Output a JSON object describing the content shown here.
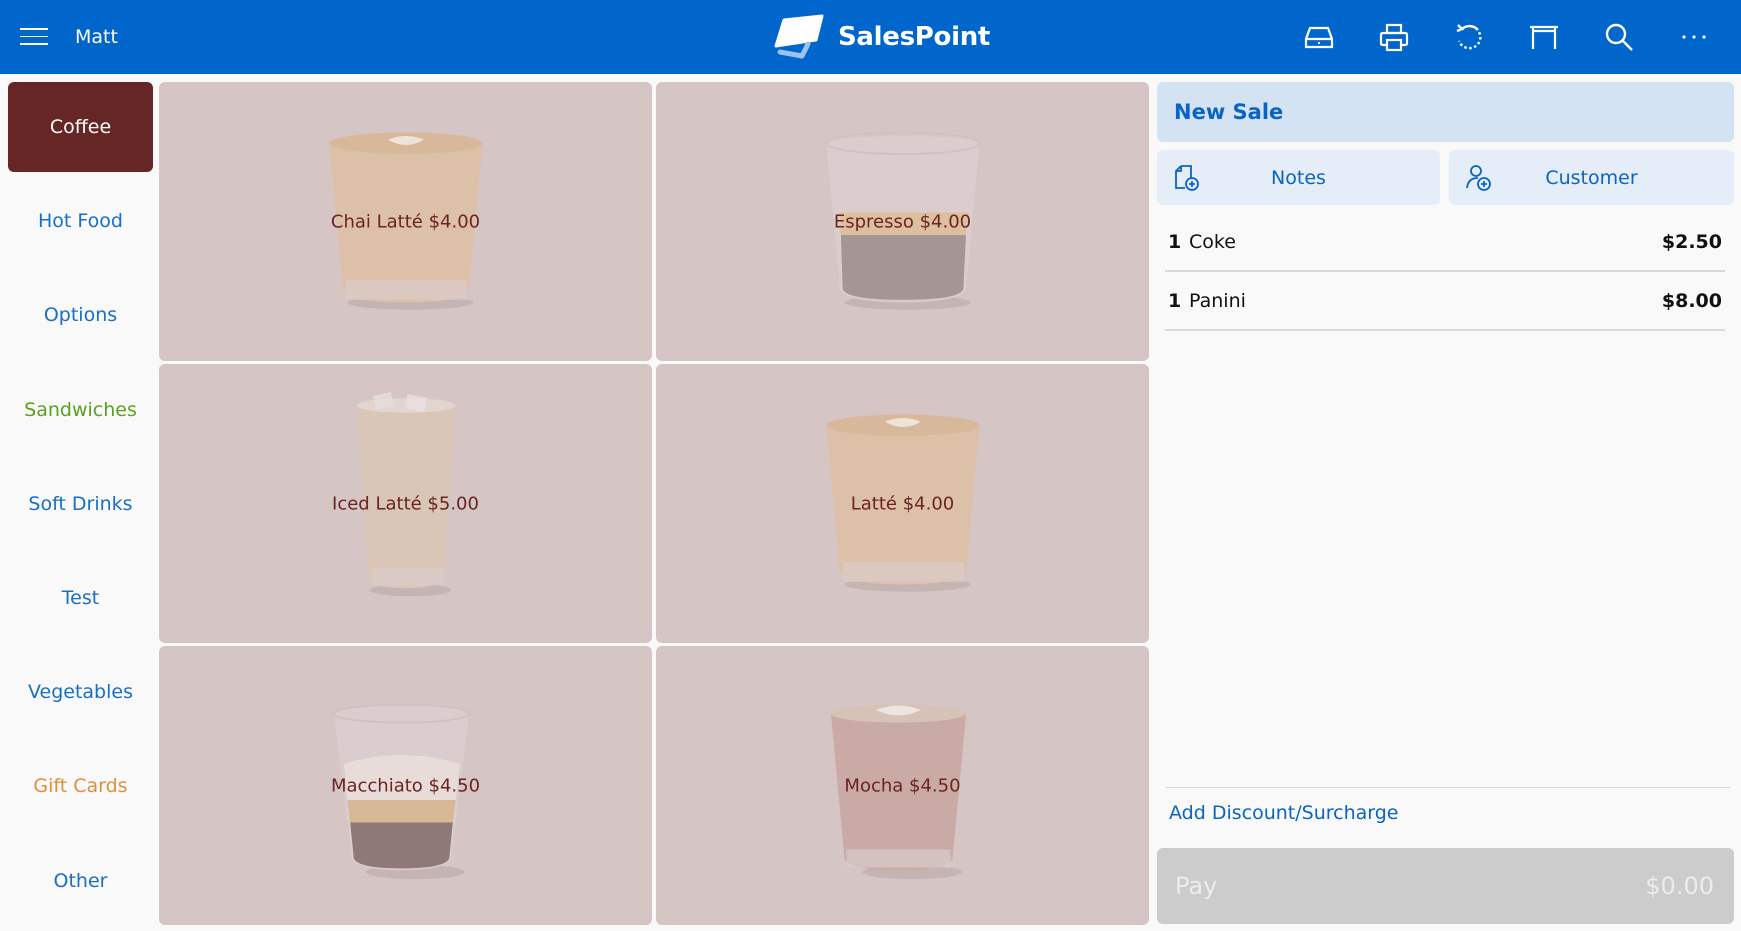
{
  "header": {
    "user_name": "Matt",
    "brand": "SalesPoint",
    "colors": {
      "bar": "#0066cc",
      "text": "#ffffff"
    },
    "toolbar": [
      {
        "name": "cash-drawer-icon",
        "label": "Cash Drawer"
      },
      {
        "name": "printer-icon",
        "label": "Print"
      },
      {
        "name": "refresh-icon",
        "label": "Refresh"
      },
      {
        "name": "table-icon",
        "label": "Tables"
      },
      {
        "name": "search-icon",
        "label": "Search"
      },
      {
        "name": "more-icon",
        "label": "More"
      }
    ]
  },
  "sidebar": {
    "categories": [
      {
        "label": "Coffee",
        "color": "#ffffff",
        "active": true
      },
      {
        "label": "Hot Food",
        "color": "#1a6fc4",
        "active": false
      },
      {
        "label": "Options",
        "color": "#1a6fc4",
        "active": false
      },
      {
        "label": "Sandwiches",
        "color": "#5aa21e",
        "active": false
      },
      {
        "label": "Soft Drinks",
        "color": "#1a6fc4",
        "active": false
      },
      {
        "label": "Test",
        "color": "#1a6fc4",
        "active": false
      },
      {
        "label": "Vegetables",
        "color": "#1a6fc4",
        "active": false
      },
      {
        "label": "Gift Cards",
        "color": "#e08e3c",
        "active": false
      },
      {
        "label": "Other",
        "color": "#1a6fc4",
        "active": false
      }
    ],
    "active_color": "#662626"
  },
  "products": [
    {
      "label": "Chai Latté $4.00",
      "drink": "latte"
    },
    {
      "label": "Espresso $4.00",
      "drink": "espresso"
    },
    {
      "label": "Iced Latté $5.00",
      "drink": "iced"
    },
    {
      "label": "Latté $4.00",
      "drink": "latte"
    },
    {
      "label": "Macchiato $4.50",
      "drink": "macchiato"
    },
    {
      "label": "Mocha $4.50",
      "drink": "mocha"
    }
  ],
  "sale": {
    "title": "New Sale",
    "notes_label": "Notes",
    "customer_label": "Customer",
    "items": [
      {
        "qty": "1",
        "name": "Coke",
        "price": "$2.50"
      },
      {
        "qty": "1",
        "name": "Panini",
        "price": "$8.00"
      }
    ],
    "discount_label": "Add Discount/Surcharge",
    "pay_label": "Pay",
    "pay_total": "$0.00"
  }
}
